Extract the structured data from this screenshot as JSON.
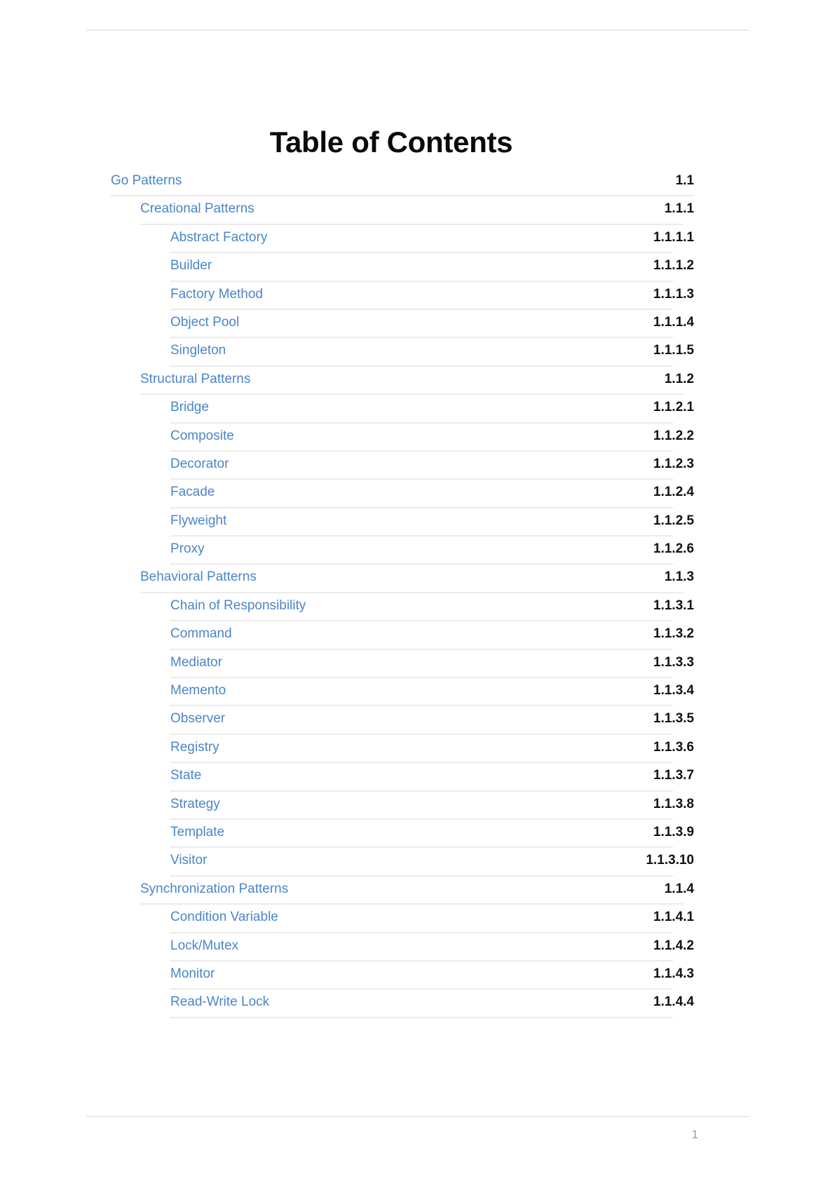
{
  "document": {
    "title": "Table of Contents",
    "page_number": "1",
    "link_color": "#4a86c8",
    "number_color": "#111111",
    "rule_color": "#ececec"
  },
  "toc": {
    "entries": [
      {
        "label": "Go Patterns",
        "number": "1.1",
        "level": 1
      },
      {
        "label": "Creational Patterns",
        "number": "1.1.1",
        "level": 2
      },
      {
        "label": "Abstract Factory",
        "number": "1.1.1.1",
        "level": 3
      },
      {
        "label": "Builder",
        "number": "1.1.1.2",
        "level": 3
      },
      {
        "label": "Factory Method",
        "number": "1.1.1.3",
        "level": 3
      },
      {
        "label": "Object Pool",
        "number": "1.1.1.4",
        "level": 3
      },
      {
        "label": "Singleton",
        "number": "1.1.1.5",
        "level": 3
      },
      {
        "label": "Structural Patterns",
        "number": "1.1.2",
        "level": 2
      },
      {
        "label": "Bridge",
        "number": "1.1.2.1",
        "level": 3
      },
      {
        "label": "Composite",
        "number": "1.1.2.2",
        "level": 3
      },
      {
        "label": "Decorator",
        "number": "1.1.2.3",
        "level": 3
      },
      {
        "label": "Facade",
        "number": "1.1.2.4",
        "level": 3
      },
      {
        "label": "Flyweight",
        "number": "1.1.2.5",
        "level": 3
      },
      {
        "label": "Proxy",
        "number": "1.1.2.6",
        "level": 3
      },
      {
        "label": "Behavioral Patterns",
        "number": "1.1.3",
        "level": 2
      },
      {
        "label": "Chain of Responsibility",
        "number": "1.1.3.1",
        "level": 3
      },
      {
        "label": "Command",
        "number": "1.1.3.2",
        "level": 3
      },
      {
        "label": "Mediator",
        "number": "1.1.3.3",
        "level": 3
      },
      {
        "label": "Memento",
        "number": "1.1.3.4",
        "level": 3
      },
      {
        "label": "Observer",
        "number": "1.1.3.5",
        "level": 3
      },
      {
        "label": "Registry",
        "number": "1.1.3.6",
        "level": 3
      },
      {
        "label": "State",
        "number": "1.1.3.7",
        "level": 3
      },
      {
        "label": "Strategy",
        "number": "1.1.3.8",
        "level": 3
      },
      {
        "label": "Template",
        "number": "1.1.3.9",
        "level": 3
      },
      {
        "label": "Visitor",
        "number": "1.1.3.10",
        "level": 3
      },
      {
        "label": "Synchronization Patterns",
        "number": "1.1.4",
        "level": 2
      },
      {
        "label": "Condition Variable",
        "number": "1.1.4.1",
        "level": 3
      },
      {
        "label": "Lock/Mutex",
        "number": "1.1.4.2",
        "level": 3
      },
      {
        "label": "Monitor",
        "number": "1.1.4.3",
        "level": 3
      },
      {
        "label": "Read-Write Lock",
        "number": "1.1.4.4",
        "level": 3
      }
    ]
  }
}
